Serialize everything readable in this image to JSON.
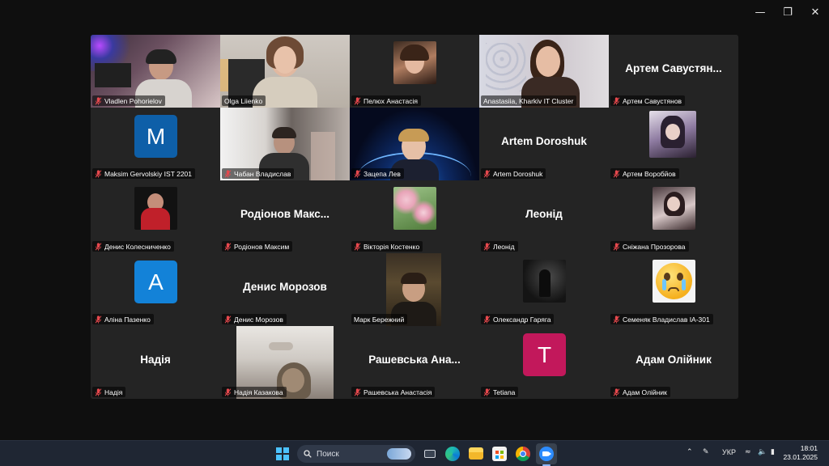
{
  "window": {
    "controls": {
      "minimize": "—",
      "restore": "❐",
      "close": "✕"
    }
  },
  "participants": [
    {
      "label": "Vladlen Pohorielov",
      "muted": true
    },
    {
      "label": "Olga Liienko",
      "muted": false
    },
    {
      "label": "Пелюх Анастасія",
      "muted": true
    },
    {
      "label": "Anastasiia, Kharkiv IT Cluster",
      "muted": false,
      "speaking": true
    },
    {
      "label": "Артем Савустянов",
      "muted": true,
      "display": "Артем  Савустян..."
    },
    {
      "label": "Maksim Gervolskiy IST 2201",
      "muted": true,
      "avatar_letter": "M",
      "avatar_color": "#0e5fa8"
    },
    {
      "label": "Чабан Владислав",
      "muted": true
    },
    {
      "label": "Зацепа Лев",
      "muted": true
    },
    {
      "label": "Artem Doroshuk",
      "muted": true,
      "display": "Artem Doroshuk"
    },
    {
      "label": "Артем Воробйов",
      "muted": true
    },
    {
      "label": "Денис Колесниченко",
      "muted": true
    },
    {
      "label": "Родіонов Максим",
      "muted": true,
      "display": "Родіонов  Макс..."
    },
    {
      "label": "Вікторія Костенко",
      "muted": true
    },
    {
      "label": "Леонід",
      "muted": true,
      "display": "Леонід"
    },
    {
      "label": "Сніжана Прозорова",
      "muted": true
    },
    {
      "label": "Аліна Пазенко",
      "muted": true,
      "avatar_letter": "A",
      "avatar_color": "#1382d8"
    },
    {
      "label": "Денис Морозов",
      "muted": true,
      "display": "Денис Морозов"
    },
    {
      "label": "Марк Бережний",
      "muted": false
    },
    {
      "label": "Олександр Гаряга",
      "muted": true
    },
    {
      "label": "Семеняк Владислав ІА-301",
      "muted": true
    },
    {
      "label": "Надія",
      "muted": true,
      "display": "Надія"
    },
    {
      "label": "Надія Казакова",
      "muted": true
    },
    {
      "label": "Рашевська Анастасія",
      "muted": true,
      "display": "Рашевська  Ана..."
    },
    {
      "label": "Tetiana",
      "muted": true,
      "avatar_letter": "T",
      "avatar_color": "#c2185b"
    },
    {
      "label": "Адам Олійник",
      "muted": true,
      "display": "Адам Олійник"
    }
  ],
  "taskbar": {
    "search_placeholder": "Поиск",
    "language": "УКР",
    "time": "18:01",
    "date": "23.01.2025",
    "icons": [
      "windows-start-icon",
      "search-icon",
      "task-view-icon",
      "edge-icon",
      "file-explorer-icon",
      "microsoft-store-icon",
      "chrome-icon",
      "zoom-icon"
    ],
    "colors": {
      "accent": "#4cc2ff",
      "speaking_border": "#23d18b",
      "muted_icon": "#e5484d"
    }
  }
}
